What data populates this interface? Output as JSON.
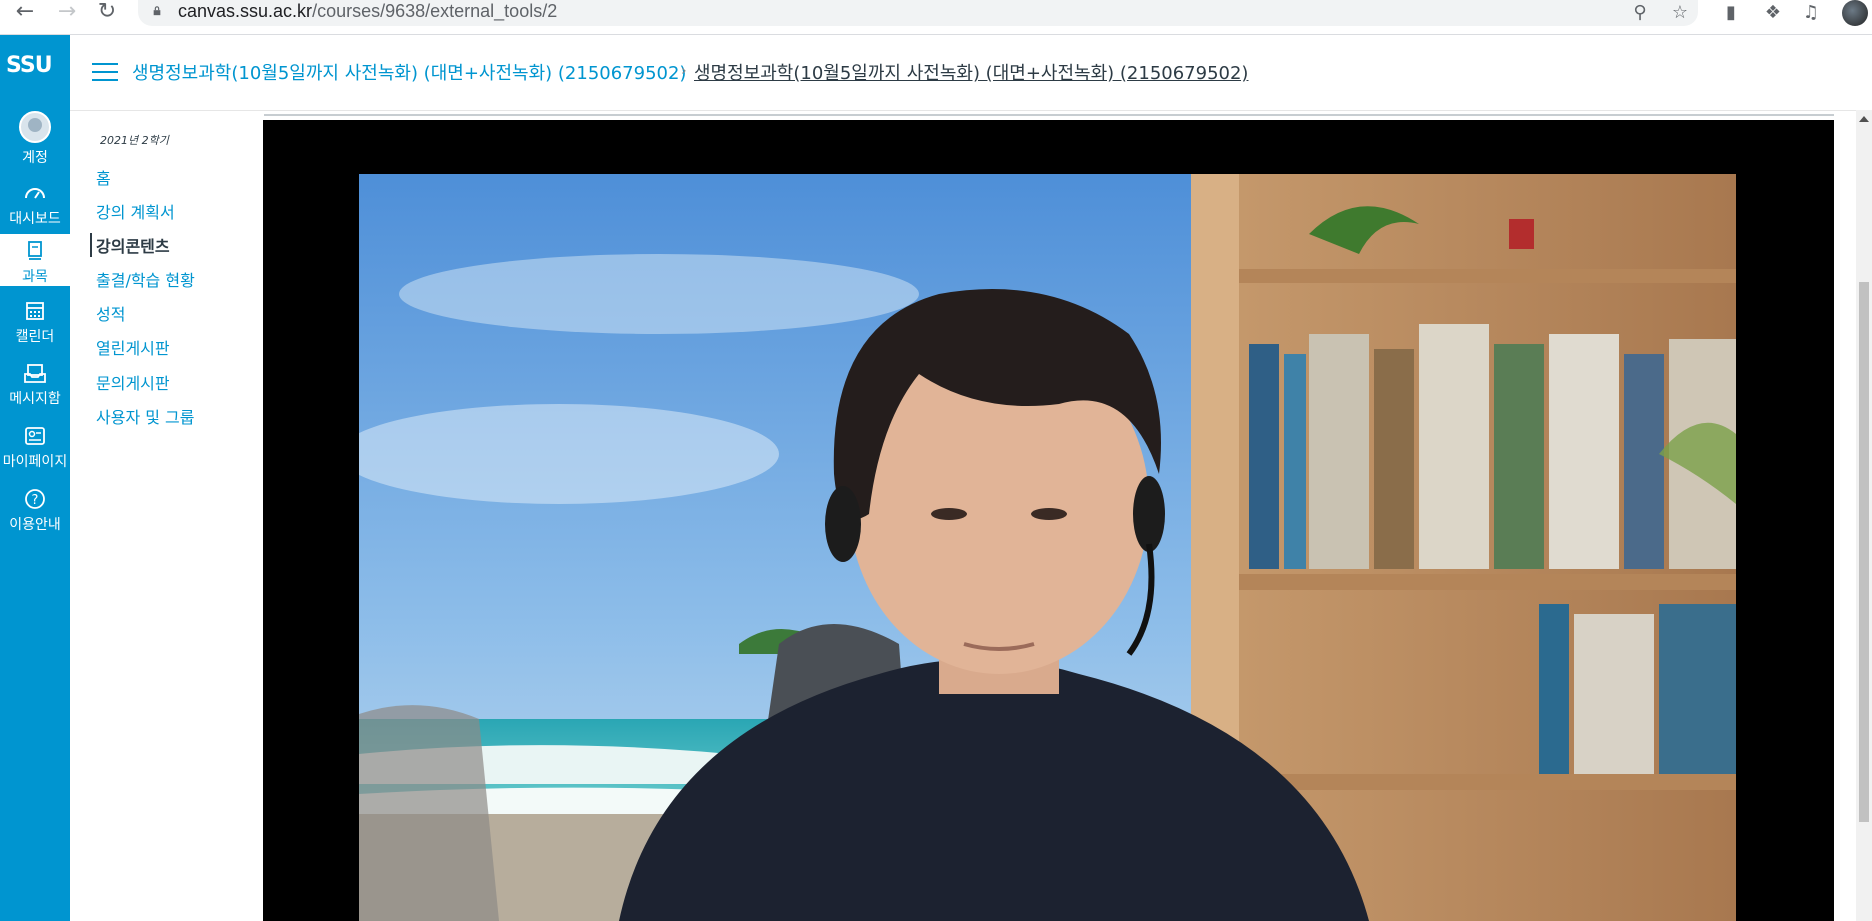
{
  "browser": {
    "url_host": "canvas.ssu.ac.kr",
    "url_path": "/courses/9638/external_tools/2"
  },
  "global_nav": {
    "logo_text": "SSU",
    "items": [
      {
        "label": "계정",
        "icon": "account-icon"
      },
      {
        "label": "대시보드",
        "icon": "dashboard-icon"
      },
      {
        "label": "과목",
        "icon": "courses-icon"
      },
      {
        "label": "캘린더",
        "icon": "calendar-icon"
      },
      {
        "label": "메시지함",
        "icon": "inbox-icon"
      },
      {
        "label": "마이페이지",
        "icon": "mypage-icon"
      },
      {
        "label": "이용안내",
        "icon": "help-icon"
      }
    ]
  },
  "header": {
    "breadcrumb_course": "생명정보과학(10월5일까지 사전녹화) (대면+사전녹화) (2150679502)",
    "breadcrumb_current": "생명정보과학(10월5일까지 사전녹화) (대면+사전녹화) (2150679502)"
  },
  "course_nav": {
    "term": "2021년 2학기",
    "items": [
      "홈",
      "강의 계획서",
      "강의콘텐츠",
      "출결/학습 현황",
      "성적",
      "열린게시판",
      "문의게시판",
      "사용자 및 그룹"
    ],
    "active_index": 2
  },
  "colors": {
    "brand": "#0095d0",
    "text": "#2d3b45"
  }
}
